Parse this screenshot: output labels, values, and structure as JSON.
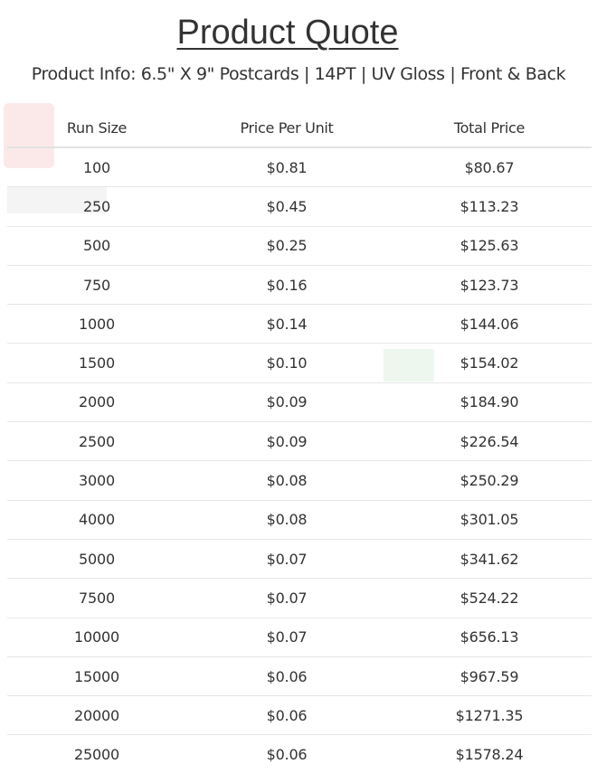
{
  "title": "Product Quote",
  "product_info": "Product Info:  6.5\" X 9\" Postcards | 14PT | UV Gloss | Front & Back",
  "table": {
    "headers": [
      "Run Size",
      "Price Per Unit",
      "Total Price"
    ],
    "rows": [
      [
        "100",
        "$0.81",
        "$80.67"
      ],
      [
        "250",
        "$0.45",
        "$113.23"
      ],
      [
        "500",
        "$0.25",
        "$125.63"
      ],
      [
        "750",
        "$0.16",
        "$123.73"
      ],
      [
        "1000",
        "$0.14",
        "$144.06"
      ],
      [
        "1500",
        "$0.10",
        "$154.02"
      ],
      [
        "2000",
        "$0.09",
        "$184.90"
      ],
      [
        "2500",
        "$0.09",
        "$226.54"
      ],
      [
        "3000",
        "$0.08",
        "$250.29"
      ],
      [
        "4000",
        "$0.08",
        "$301.05"
      ],
      [
        "5000",
        "$0.07",
        "$341.62"
      ],
      [
        "7500",
        "$0.07",
        "$524.22"
      ],
      [
        "10000",
        "$0.07",
        "$656.13"
      ],
      [
        "15000",
        "$0.06",
        "$967.59"
      ],
      [
        "20000",
        "$0.06",
        "$1271.35"
      ],
      [
        "25000",
        "$0.06",
        "$1578.24"
      ]
    ]
  }
}
